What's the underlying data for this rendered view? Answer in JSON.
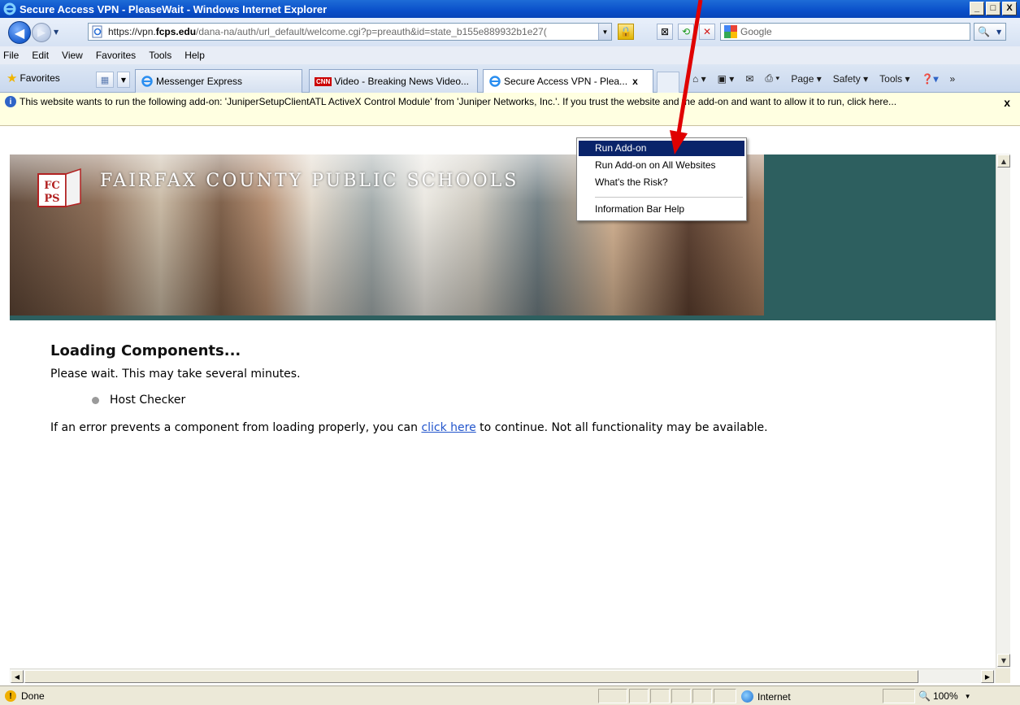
{
  "window": {
    "title": "Secure Access VPN - PleaseWait - Windows Internet Explorer",
    "min_label": "_",
    "max_label": "□",
    "close_label": "X"
  },
  "address": {
    "url_prefix": "https://vpn.",
    "url_domain": "fcps.edu",
    "url_rest": "/dana-na/auth/url_default/welcome.cgi?p=preauth&id=state_b155e889932b1e27("
  },
  "search": {
    "placeholder": "Google"
  },
  "menu": {
    "items": [
      "File",
      "Edit",
      "View",
      "Favorites",
      "Tools",
      "Help"
    ]
  },
  "favorites": {
    "label": "Favorites"
  },
  "tabs": [
    {
      "label": "Messenger Express",
      "icon": "ie-icon"
    },
    {
      "label": "Video - Breaking News Video...",
      "icon": "cnn-icon",
      "badge": "CNN"
    },
    {
      "label": "Secure Access VPN - Plea...",
      "icon": "ie-icon",
      "close": "x",
      "active": true
    }
  ],
  "commandbar": {
    "items": [
      "Page ▾",
      "Safety ▾",
      "Tools ▾"
    ]
  },
  "infobar": {
    "message": "This website wants to run the following add-on: 'JuniperSetupClientATL ActiveX Control Module' from 'Juniper Networks, Inc.'. If you trust the website and the add-on and want to allow it to run, click here...",
    "close": "x"
  },
  "context_menu": {
    "items": [
      {
        "label": "Run Add-on",
        "selected": true
      },
      {
        "label": "Run Add-on on All Websites"
      },
      {
        "label": "What's the Risk?"
      },
      {
        "label": "Information Bar Help"
      }
    ]
  },
  "banner": {
    "logo_text_top": "FC",
    "logo_text_bottom": "PS",
    "school_name": "FAIRFAX COUNTY PUBLIC SCHOOLS"
  },
  "page": {
    "heading": "Loading Components...",
    "wait_text": "Please wait. This may take several minutes.",
    "components": [
      "Host Checker"
    ],
    "error_prefix": "If an error prevents a component from loading properly, you can ",
    "error_link": "click here",
    "error_suffix": " to continue. Not all functionality may be available."
  },
  "status": {
    "text": "Done",
    "zone": "Internet",
    "zoom": "100%"
  },
  "colors": {
    "titlebar": "#0a4fc9",
    "banner_teal": "#2d5f5f",
    "menu_highlight": "#0a246a",
    "infobar_bg": "#ffffe1",
    "arrow_red": "#e00000",
    "link": "#2255cc"
  }
}
